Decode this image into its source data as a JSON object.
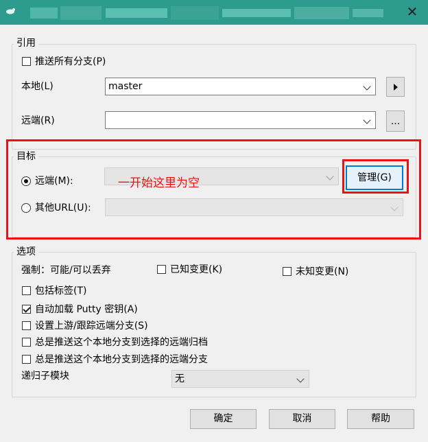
{
  "window": {
    "title_blurred": true,
    "close_glyph": "✕"
  },
  "refs_group": {
    "title": "引用",
    "push_all_branches": {
      "label": "推送所有分支(P)",
      "checked": false
    },
    "local_label": "本地(L)",
    "local_value": "master",
    "remote_label": "远端(R)",
    "remote_value": "",
    "browse_button": "..."
  },
  "target_group": {
    "title": "目标",
    "remote_radio": {
      "label": "远端(M):",
      "checked": true
    },
    "remote_value": "",
    "manage_button": "管理(G)",
    "other_url_radio": {
      "label": "其他URL(U):",
      "checked": false
    },
    "other_url_value": "",
    "annotation_text": "一开始这里为空"
  },
  "options_group": {
    "title": "选项",
    "force_label": "强制：可能/可以丢弃",
    "known_changes": {
      "label": "已知变更(K)",
      "checked": false
    },
    "unknown_changes": {
      "label": "未知变更(N)",
      "checked": false
    },
    "include_tags": {
      "label": "包括标签(T)",
      "checked": false
    },
    "autoload_putty": {
      "label": "自动加载 Putty 密钥(A)",
      "checked": true
    },
    "set_upstream": {
      "label": "设置上游/跟踪远端分支(S)",
      "checked": false
    },
    "always_push_archive": {
      "label": "总是推送这个本地分支到选择的远端归档",
      "checked": false
    },
    "always_push_branch": {
      "label": "总是推送这个本地分支到选择的远端分支",
      "checked": false
    },
    "recurse_submodules_label": "递归子模块",
    "recurse_submodules_value": "无"
  },
  "buttons": {
    "ok": "确定",
    "cancel": "取消",
    "help": "帮助"
  },
  "colors": {
    "titlebar": "#2d9b8e",
    "annotation_red": "#ee1111",
    "focus_blue": "#0078d7"
  },
  "icons": [
    "app-icon",
    "close-icon",
    "chevron-down-icon",
    "play-arrow-icon"
  ]
}
